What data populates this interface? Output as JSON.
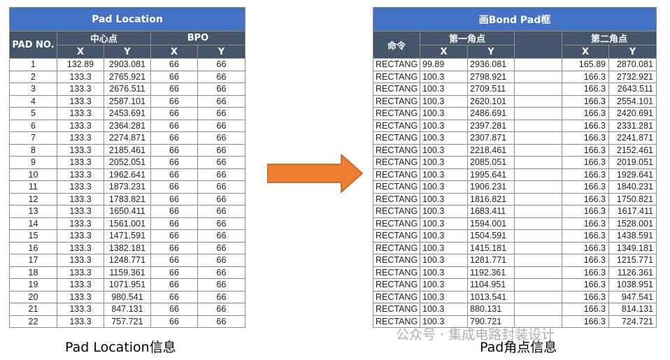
{
  "left_table": {
    "title": "Pad Location",
    "pad_no_header": "PAD NO.",
    "group1": "中心点",
    "group2": "BPO",
    "col_x": "X",
    "col_y": "Y",
    "rows": [
      [
        "1",
        "132.89",
        "2903.081",
        "66",
        "66"
      ],
      [
        "2",
        "133.3",
        "2765.921",
        "66",
        "66"
      ],
      [
        "3",
        "133.3",
        "2676.511",
        "66",
        "66"
      ],
      [
        "4",
        "133.3",
        "2587.101",
        "66",
        "66"
      ],
      [
        "5",
        "133.3",
        "2453.691",
        "66",
        "66"
      ],
      [
        "6",
        "133.3",
        "2364.281",
        "66",
        "66"
      ],
      [
        "7",
        "133.3",
        "2274.871",
        "66",
        "66"
      ],
      [
        "8",
        "133.3",
        "2185.461",
        "66",
        "66"
      ],
      [
        "9",
        "133.3",
        "2052.051",
        "66",
        "66"
      ],
      [
        "10",
        "133.3",
        "1962.641",
        "66",
        "66"
      ],
      [
        "11",
        "133.3",
        "1873.231",
        "66",
        "66"
      ],
      [
        "12",
        "133.3",
        "1783.821",
        "66",
        "66"
      ],
      [
        "13",
        "133.3",
        "1650.411",
        "66",
        "66"
      ],
      [
        "14",
        "133.3",
        "1561.001",
        "66",
        "66"
      ],
      [
        "15",
        "133.3",
        "1471.591",
        "66",
        "66"
      ],
      [
        "16",
        "133.3",
        "1382.181",
        "66",
        "66"
      ],
      [
        "17",
        "133.3",
        "1248.771",
        "66",
        "66"
      ],
      [
        "18",
        "133.3",
        "1159.361",
        "66",
        "66"
      ],
      [
        "19",
        "133.3",
        "1071.951",
        "66",
        "66"
      ],
      [
        "20",
        "133.3",
        "980.541",
        "66",
        "66"
      ],
      [
        "21",
        "133.3",
        "847.131",
        "66",
        "66"
      ],
      [
        "22",
        "133.3",
        "757.721",
        "66",
        "66"
      ]
    ]
  },
  "right_table": {
    "title": "画Bond Pad框",
    "cmd_header": "命令",
    "group1": "第一角点",
    "group2": "第二角点",
    "col_x": "X",
    "col_y": "Y",
    "rows": [
      [
        "RECTANG",
        "99.89",
        "2936.081",
        "",
        "165.89",
        "2870.081"
      ],
      [
        "RECTANG",
        "100.3",
        "2798.921",
        "",
        "166.3",
        "2732.921"
      ],
      [
        "RECTANG",
        "100.3",
        "2709.511",
        "",
        "166.3",
        "2643.511"
      ],
      [
        "RECTANG",
        "100.3",
        "2620.101",
        "",
        "166.3",
        "2554.101"
      ],
      [
        "RECTANG",
        "100.3",
        "2486.691",
        "",
        "166.3",
        "2420.691"
      ],
      [
        "RECTANG",
        "100.3",
        "2397.281",
        "",
        "166.3",
        "2331.281"
      ],
      [
        "RECTANG",
        "100.3",
        "2307.871",
        "",
        "166.3",
        "2241.871"
      ],
      [
        "RECTANG",
        "100.3",
        "2218.461",
        "",
        "166.3",
        "2152.461"
      ],
      [
        "RECTANG",
        "100.3",
        "2085.051",
        "",
        "166.3",
        "2019.051"
      ],
      [
        "RECTANG",
        "100.3",
        "1995.641",
        "",
        "166.3",
        "1929.641"
      ],
      [
        "RECTANG",
        "100.3",
        "1906.231",
        "",
        "166.3",
        "1840.231"
      ],
      [
        "RECTANG",
        "100.3",
        "1816.821",
        "",
        "166.3",
        "1750.821"
      ],
      [
        "RECTANG",
        "100.3",
        "1683.411",
        "",
        "166.3",
        "1617.411"
      ],
      [
        "RECTANG",
        "100.3",
        "1594.001",
        "",
        "166.3",
        "1528.001"
      ],
      [
        "RECTANG",
        "100.3",
        "1504.591",
        "",
        "166.3",
        "1438.591"
      ],
      [
        "RECTANG",
        "100.3",
        "1415.181",
        "",
        "166.3",
        "1349.181"
      ],
      [
        "RECTANG",
        "100.3",
        "1281.771",
        "",
        "166.3",
        "1215.771"
      ],
      [
        "RECTANG",
        "100.3",
        "1192.361",
        "",
        "166.3",
        "1126.361"
      ],
      [
        "RECTANG",
        "100.3",
        "1104.951",
        "",
        "166.3",
        "1038.951"
      ],
      [
        "RECTANG",
        "100.3",
        "1013.541",
        "",
        "166.3",
        "947.541"
      ],
      [
        "RECTANG",
        "100.3",
        "880.131",
        "",
        "166.3",
        "814.131"
      ],
      [
        "RECTANG",
        "100.3",
        "790.721",
        "",
        "166.3",
        "724.721"
      ]
    ]
  },
  "captions": {
    "left": "Pad Location信息",
    "right": "Pad角点信息"
  },
  "arrow": {
    "color": "#ed7d31",
    "icon": "arrow-right-icon"
  },
  "watermark": "公众号 · 集成电路封装设计",
  "colors": {
    "title_bg": "#4472c4",
    "header_bg": "#44546a"
  }
}
